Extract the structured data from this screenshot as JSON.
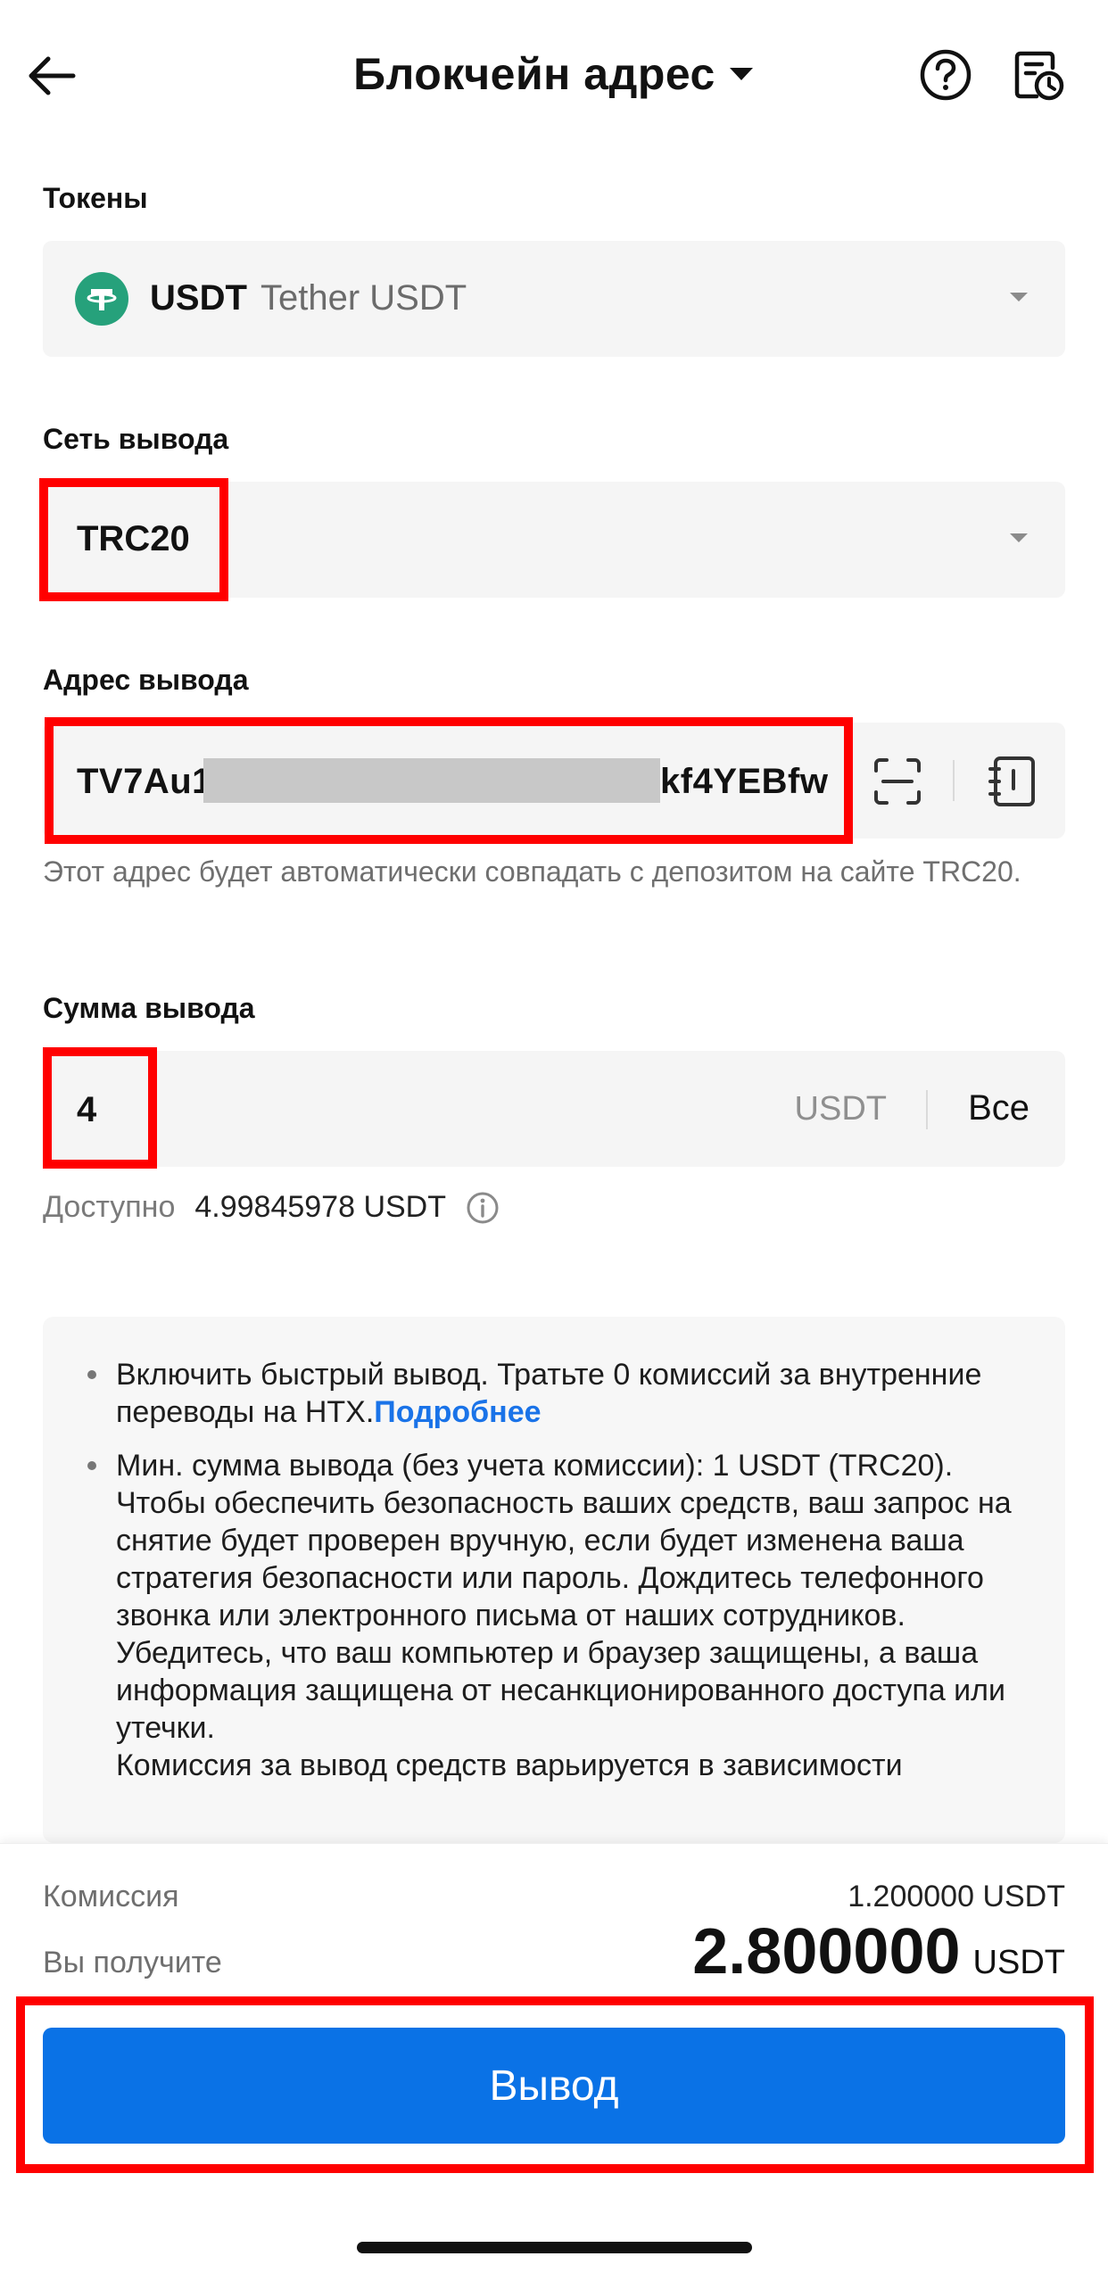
{
  "header": {
    "title": "Блокчейн адрес"
  },
  "token": {
    "label": "Токены",
    "code": "USDT",
    "name": "Tether USDT"
  },
  "network": {
    "label": "Сеть вывода",
    "value": "TRC20"
  },
  "address": {
    "label": "Адрес вывода",
    "prefix": "TV7Au1",
    "suffix": "kf4YEBfw",
    "hint": "Этот адрес будет автоматически совпадать с депозитом на сайте TRC20."
  },
  "amount": {
    "label": "Сумма вывода",
    "value": "4",
    "unit": "USDT",
    "all_label": "Все",
    "available_label": "Доступно",
    "available_value": "4.99845978 USDT"
  },
  "notes": {
    "item1_text": "Включить быстрый вывод. Тратьте 0 комиссий за внутренние переводы на HTX.",
    "item1_link": "Подробнее",
    "item2_text": "Мин. сумма вывода (без учета комиссии): 1 USDT (TRC20). Чтобы обеспечить безопасность ваших средств, ваш запрос на снятие будет проверен вручную, если будет изменена ваша стратегия безопасности или пароль. Дождитесь телефонного звонка или электронного письма от наших сотрудников.",
    "item2_text_b": "Убедитесь, что ваш компьютер и браузер защищены, а ваша информация защищена от несанкционированного доступа или утечки.",
    "item2_text_c": "Комиссия за вывод средств варьируется в зависимости"
  },
  "summary": {
    "fee_label": "Комиссия",
    "fee_value": "1.200000 USDT",
    "receive_label": "Вы получите",
    "receive_value": "2.800000",
    "receive_unit": "USDT"
  },
  "actions": {
    "withdraw_label": "Вывод"
  },
  "colors": {
    "accent": "#0a72e6",
    "highlight": "#ff0000",
    "tether": "#26a17b",
    "link": "#1a73e8"
  }
}
